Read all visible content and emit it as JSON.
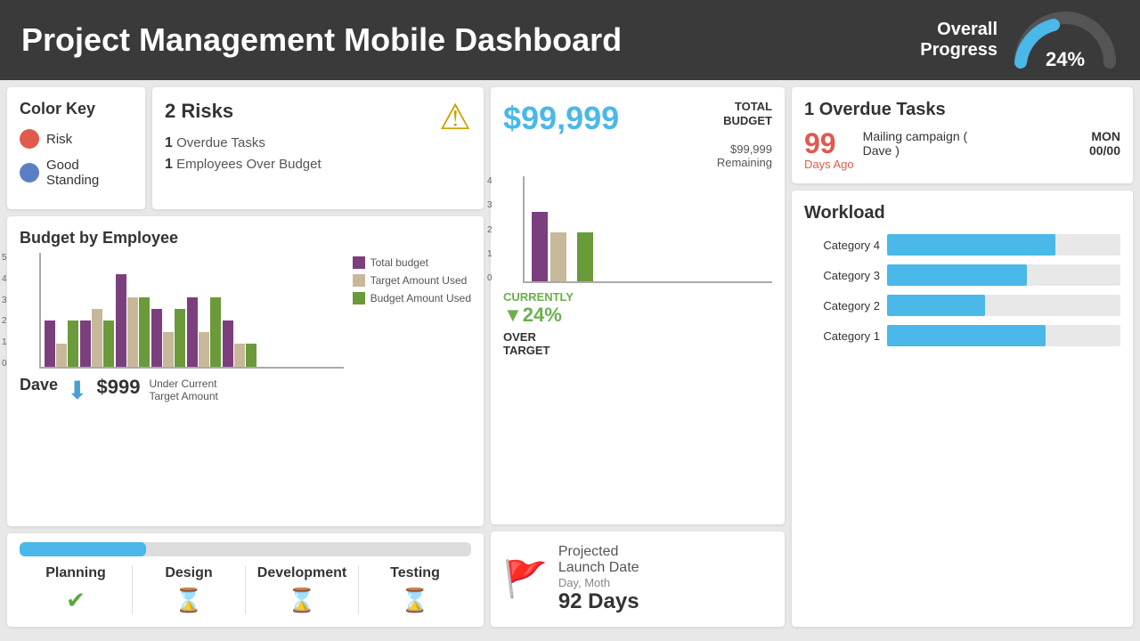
{
  "header": {
    "title": "Project Management Mobile Dashboard",
    "progress_label": "Overall\nProgress",
    "progress_pct": "24%"
  },
  "color_key": {
    "title": "Color Key",
    "items": [
      {
        "label": "Risk",
        "type": "risk"
      },
      {
        "label": "Good\nStanding",
        "type": "good"
      }
    ]
  },
  "risks": {
    "count": "2",
    "label": "Risks",
    "items": [
      {
        "count": "1",
        "label": "Overdue Tasks"
      },
      {
        "count": "1",
        "label": "Employees Over Budget"
      }
    ]
  },
  "budget_by_employee": {
    "title": "Budget by Employee",
    "legend": [
      {
        "label": "Total budget",
        "type": "purple"
      },
      {
        "label": "Target Amount Used",
        "type": "tan"
      },
      {
        "label": "Budget Amount Used",
        "type": "green"
      }
    ],
    "dave": {
      "name": "Dave",
      "amount": "$999",
      "sub_label": "Under Current\nTarget Amount"
    }
  },
  "budget_overview": {
    "big_number": "$99,999",
    "budget_label": "TOTAL\nBUDGET",
    "remaining": "$99,999\nRemaining",
    "currently_label": "CURRENTLY",
    "currently_pct": "▼24%",
    "over_target": "OVER\nTARGET"
  },
  "launch": {
    "title": "Projected\nLaunch Date",
    "subtitle": "Day, Moth",
    "days": "92 Days"
  },
  "overdue": {
    "count": "1",
    "label": "Overdue Tasks",
    "days_ago": "99",
    "days_ago_label": "Days Ago",
    "task_name": "Mailing campaign (\nDave )",
    "task_date_line1": "MON",
    "task_date_line2": "00/00"
  },
  "workload": {
    "title": "Workload",
    "categories": [
      {
        "label": "Category 4",
        "pct": 72
      },
      {
        "label": "Category 3",
        "pct": 60
      },
      {
        "label": "Category 2",
        "pct": 42
      },
      {
        "label": "Category 1",
        "pct": 68
      }
    ]
  },
  "progress_stages": {
    "bar_pct": 28,
    "stages": [
      {
        "name": "Planning",
        "icon": "check",
        "done": true
      },
      {
        "name": "Design",
        "icon": "hourglass",
        "done": false
      },
      {
        "name": "Development",
        "icon": "hourglass",
        "done": false
      },
      {
        "name": "Testing",
        "icon": "hourglass",
        "done": false
      }
    ]
  }
}
